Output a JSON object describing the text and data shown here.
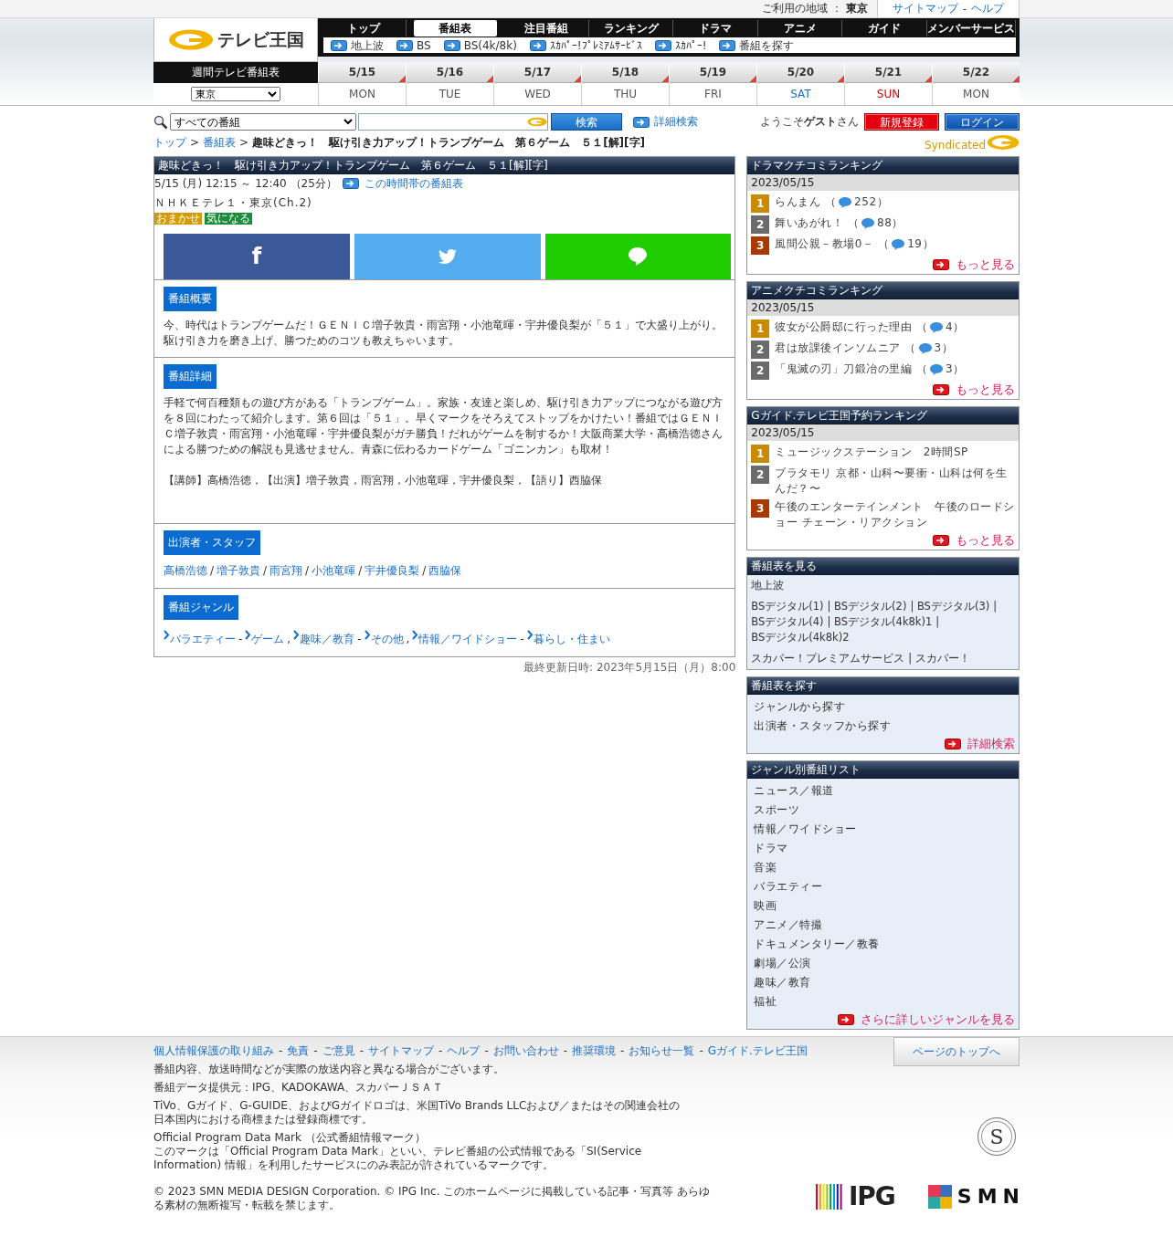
{
  "top_bar": {
    "region_label": "ご利用の地域 ：",
    "region": "東京",
    "links": [
      "サイトマップ",
      "ヘルプ"
    ],
    "separator": "-"
  },
  "logo": {
    "text": "テレビ王国"
  },
  "nav": {
    "tabs": [
      {
        "label": "トップ",
        "selected": false
      },
      {
        "label": "番組表",
        "selected": true
      },
      {
        "label": "注目番組",
        "selected": false
      },
      {
        "label": "ランキング",
        "selected": false
      },
      {
        "label": "ドラマ",
        "selected": false
      },
      {
        "label": "アニメ",
        "selected": false
      },
      {
        "label": "ガイド",
        "selected": false
      },
      {
        "label": "メンバーサービス",
        "selected": false
      }
    ],
    "subnav": [
      "地上波",
      "BS",
      "BS(4k/8k)",
      "ｽｶﾊﾟｰ!ﾌﾟﾚﾐｱﾑｻｰﾋﾞｽ",
      "ｽｶﾊﾟｰ!",
      "番組を探す"
    ]
  },
  "schedule": {
    "title": "週間テレビ番組表",
    "region_select": "東京",
    "days": [
      {
        "date": "5/15",
        "weekday": "MON",
        "kind": "weekday"
      },
      {
        "date": "5/16",
        "weekday": "TUE",
        "kind": "weekday"
      },
      {
        "date": "5/17",
        "weekday": "WED",
        "kind": "weekday"
      },
      {
        "date": "5/18",
        "weekday": "THU",
        "kind": "weekday"
      },
      {
        "date": "5/19",
        "weekday": "FRI",
        "kind": "weekday"
      },
      {
        "date": "5/20",
        "weekday": "SAT",
        "kind": "saturday"
      },
      {
        "date": "5/21",
        "weekday": "SUN",
        "kind": "sunday"
      },
      {
        "date": "5/22",
        "weekday": "MON",
        "kind": "weekday"
      }
    ]
  },
  "search": {
    "scope": "すべての番組",
    "button": "検索",
    "advanced": "詳細検索"
  },
  "user": {
    "welcome": "ようこそ**ゲスト**さん",
    "register": "新規登録",
    "login": "ログイン"
  },
  "breadcrumb": {
    "links": [
      "トップ",
      "番組表"
    ],
    "separator": ">",
    "current": "趣味どきっ！　駆け引き力アップ！トランプゲーム　第６ゲーム　５１[解][字]"
  },
  "syndicated_logo": {
    "text": "Syndicated"
  },
  "program": {
    "title": "趣味どきっ！　駆け引き力アップ！トランプゲーム　第６ゲーム　５１[解][字]",
    "time": "5/15 (月) 12:15 ～ 12:40 （25分）",
    "time_link": "この時間帯の番組表",
    "channel": "ＮＨＫＥテレ１・東京(Ch.2)",
    "tags": [
      {
        "label": "おまかせ",
        "color": "#d49a00"
      },
      {
        "label": "気になる",
        "color": "#1d8c3a"
      }
    ],
    "share": [
      {
        "kind": "facebook",
        "glyph": "f"
      },
      {
        "kind": "twitter"
      },
      {
        "kind": "line"
      }
    ],
    "sections": [
      {
        "kind": "text",
        "heading": "番組概要",
        "paragraphs": [
          "今、時代はトランプゲームだ！ＧＥＮＩＣ増子敦貴・雨宮翔・小池竜暉・宇井優良梨が「５１」で大盛り上がり。駆け引き力を磨き上げ、勝つためのコツも教えちゃいます。"
        ]
      },
      {
        "kind": "text",
        "heading": "番組詳細",
        "paragraphs": [
          "手軽で何百種類もの遊び方がある「トランプゲーム」。家族・友達と楽しめ、駆け引き力アップにつながる遊び方を８回にわたって紹介します。第６回は「５１」。早くマークをそろえてストップをかけたい！番組ではＧＥＮＩＣ増子敦貴・雨宮翔・小池竜暉・宇井優良梨がガチ勝負！だれがゲームを制するか！大阪商業大学・高橋浩徳さんによる勝つための解説も見逃せません。青森に伝わるカードゲーム「ゴニンカン」も取材！",
          "【講師】高橋浩徳，【出演】増子敦貴，雨宮翔，小池竜暉，宇井優良梨，【語り】西脇保"
        ]
      },
      {
        "kind": "people",
        "heading": "出演者・スタッフ",
        "separator": "/",
        "links": [
          "高橋浩徳",
          "増子敦貴",
          "雨宮翔",
          "小池竜暉",
          "宇井優良梨",
          "西脇保"
        ]
      },
      {
        "kind": "genres",
        "heading": "番組ジャンル",
        "pair_separator": "-",
        "group_separator": ",",
        "genres": [
          {
            "main": "バラエティー",
            "sub": "ゲーム"
          },
          {
            "main": "趣味／教育",
            "sub": "その他"
          },
          {
            "main": "情報／ワイドショー",
            "sub": "暮らし・住まい"
          }
        ]
      }
    ],
    "updated": "最終更新日時: 2023年5月15日（月）8:00"
  },
  "sidebar": [
    {
      "kind": "ranking",
      "title": "ドラマクチコミランキング",
      "date": "2023/05/15",
      "more": "もっと見る",
      "items": [
        {
          "rank": "1",
          "color": "#c98a00",
          "title": "らんまん （",
          "count": "252）"
        },
        {
          "rank": "2",
          "color": "#6b6b6b",
          "title": "舞いあがれ！ （",
          "count": "88）"
        },
        {
          "rank": "3",
          "color": "#a83a00",
          "title": "風間公親－教場0－ （",
          "count": "19）"
        }
      ]
    },
    {
      "kind": "ranking",
      "title": "アニメクチコミランキング",
      "date": "2023/05/15",
      "more": "もっと見る",
      "items": [
        {
          "rank": "1",
          "color": "#c98a00",
          "title": "彼女が公爵邸に行った理由 （",
          "count": "4）"
        },
        {
          "rank": "2",
          "color": "#6b6b6b",
          "title": "君は放課後インソムニア （",
          "count": "3）"
        },
        {
          "rank": "2",
          "color": "#6b6b6b",
          "title": "「鬼滅の刃」刀鍛冶の里編 （",
          "count": "3）"
        }
      ]
    },
    {
      "kind": "ranking",
      "title": "Gガイド.テレビ王国予約ランキング",
      "date": "2023/05/15",
      "more": "もっと見る",
      "items": [
        {
          "rank": "1",
          "color": "#c98a00",
          "title": "ミュージックステーション　2時間SP"
        },
        {
          "rank": "2",
          "color": "#6b6b6b",
          "title": "ブラタモリ 京都・山科〜要衝・山科は何を生んだ？〜"
        },
        {
          "rank": "3",
          "color": "#a83a00",
          "title": "午後のエンターテインメント　午後のロードショー チェーン・リアクション"
        }
      ]
    },
    {
      "kind": "channels",
      "title": "番組表を見る",
      "separator": "|",
      "groups": [
        [
          "地上波"
        ],
        [
          "BSデジタル(1)",
          "BSデジタル(2)",
          "BSデジタル(3)",
          "BSデジタル(4)",
          "BSデジタル(4k8k)1",
          "BSデジタル(4k8k)2"
        ],
        [
          "スカパー！プレミアムサービス",
          "スカパー！"
        ]
      ]
    },
    {
      "kind": "list",
      "title": "番組表を探す",
      "items": [
        "ジャンルから探す",
        "出演者・スタッフから探す"
      ],
      "more": "詳細検索"
    },
    {
      "kind": "list",
      "title": "ジャンル別番組リスト",
      "items": [
        "ニュース／報道",
        "スポーツ",
        "情報／ワイドショー",
        "ドラマ",
        "音楽",
        "バラエティー",
        "映画",
        "アニメ／特撮",
        "ドキュメンタリー／教養",
        "劇場／公演",
        "趣味／教育",
        "福祉"
      ],
      "more": "さらに詳しいジャンルを見る"
    }
  ],
  "footer": {
    "separator": "-",
    "links": [
      "個人情報保護の取り組み",
      "免責",
      "ご意見",
      "サイトマップ",
      "ヘルプ",
      "お問い合わせ",
      "推奨環境",
      "お知らせ一覧",
      "Gガイド.テレビ王国"
    ],
    "page_top": "ページのトップへ",
    "notes": [
      [
        "番組内容、放送時間などが実際の放送内容と異なる場合がございます。"
      ],
      [
        "番組データ提供元：IPG、KADOKAWA、スカパーＪＳＡＴ"
      ],
      [
        "TiVo、Gガイド、G-GUIDE、およびGガイドロゴは、米国TiVo Brands LLCおよび／またはその関連会社の日本国内における商標または登録商標です。"
      ],
      [
        "Official Program Data Mark （公式番組情報マーク）",
        "このマークは「Official Program Data Mark」といい、テレビ番組の公式情報である「SI(Service Information) 情報」を利用したサービスにのみ表記が許されているマークです。"
      ]
    ],
    "copyright": "© 2023 SMN MEDIA DESIGN Corporation. © IPG Inc. このホームページに掲載している記事・写真等 あらゆる素材の無断複写・転載を禁じます。",
    "seal": "S",
    "logos": [
      {
        "kind": "ipg",
        "text": "IPG"
      },
      {
        "kind": "smn",
        "text": "SMN"
      }
    ]
  }
}
